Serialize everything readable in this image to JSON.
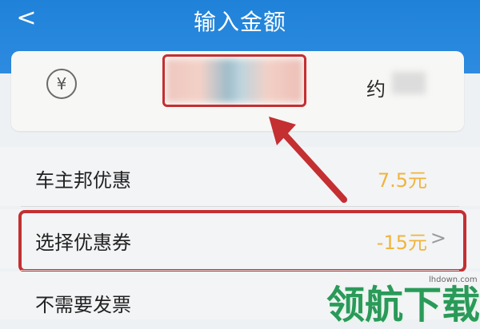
{
  "header": {
    "back_glyph": "<",
    "title": "输入金额"
  },
  "amount": {
    "currency_glyph": "¥",
    "approx_label": "约"
  },
  "rows": [
    {
      "label": "车主邦优惠",
      "value": "7.5元"
    },
    {
      "label": "选择优惠券",
      "value": "-15元",
      "chevron": ">"
    },
    {
      "label": "不需要发票"
    }
  ],
  "watermark": {
    "text": "领航下载",
    "url": "lhdown.com"
  },
  "colors": {
    "header": "#2d8be0",
    "highlight": "#c42f32",
    "value": "#f0b43c",
    "watermark": "#2a9a59"
  }
}
